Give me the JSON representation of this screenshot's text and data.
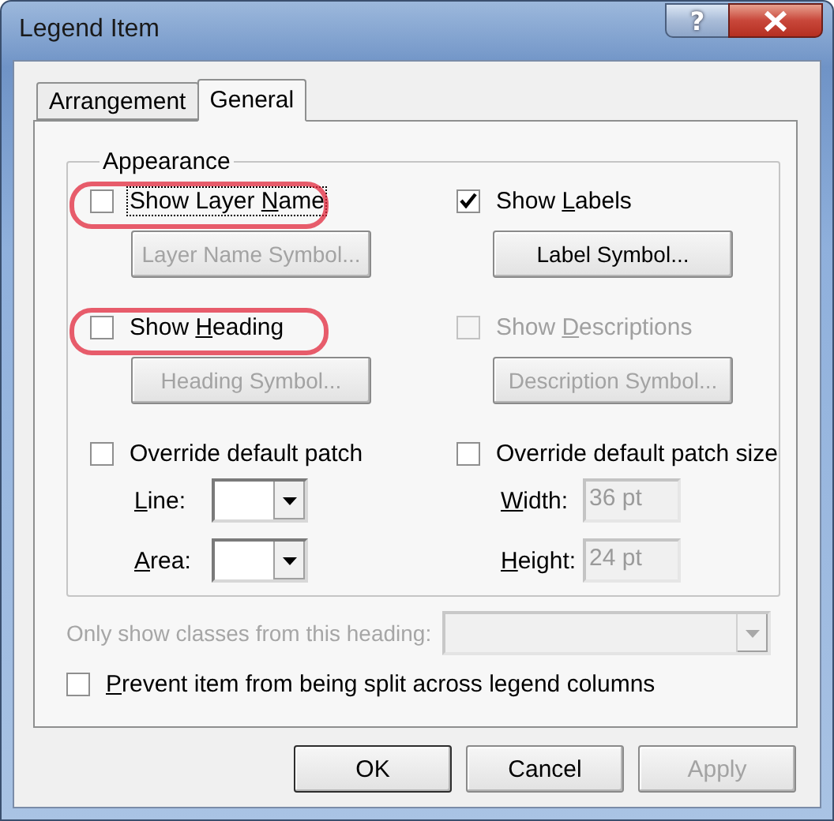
{
  "window": {
    "title": "Legend Item",
    "help_label": "?"
  },
  "tabs": [
    {
      "label": "Arrangement",
      "selected": false
    },
    {
      "label": "General",
      "selected": true
    }
  ],
  "appearance": {
    "title": "Appearance",
    "items": [
      {
        "kind": "checkbox",
        "label": "Show Layer ",
        "access_key": "N",
        "label_end": "ame",
        "checked": false,
        "disabled": false,
        "highlighted": true,
        "focused": true
      },
      {
        "kind": "checkbox",
        "label": "Show ",
        "access_key": "L",
        "label_end": "abels",
        "checked": true,
        "disabled": false,
        "highlighted": false,
        "focused": false
      },
      {
        "kind": "button",
        "label": "Layer Name Symbol...",
        "disabled": true
      },
      {
        "kind": "button",
        "label": "Label Symbol...",
        "disabled": false
      },
      {
        "kind": "checkbox",
        "label": "Show ",
        "access_key": "H",
        "label_end": "eading",
        "checked": false,
        "disabled": false,
        "highlighted": true,
        "focused": false
      },
      {
        "kind": "checkbox",
        "label": "Show ",
        "access_key": "D",
        "label_end": "escriptions",
        "checked": false,
        "disabled": true,
        "highlighted": false,
        "focused": false
      },
      {
        "kind": "button",
        "label": "Heading Symbol...",
        "disabled": true
      },
      {
        "kind": "button",
        "label": "Description Symbol...",
        "disabled": true
      },
      {
        "kind": "checkbox",
        "label": "Override default patch",
        "checked": false,
        "disabled": false,
        "highlighted": false,
        "focused": false
      },
      {
        "kind": "checkbox",
        "label": "Override default patch size",
        "checked": false,
        "disabled": false,
        "highlighted": false,
        "focused": false
      },
      {
        "kind": "combo",
        "access_key": "L",
        "label_end": "ine:",
        "disabled": false
      },
      {
        "kind": "field",
        "access_key": "W",
        "label_end": "idth:",
        "value": "36 pt",
        "disabled": true
      },
      {
        "kind": "combo",
        "access_key": "A",
        "label_end": "rea:",
        "disabled": false
      },
      {
        "kind": "field",
        "access_key": "H",
        "label_end": "eight:",
        "value": "24 pt",
        "disabled": true
      }
    ]
  },
  "heading_filter": {
    "label": "Only show classes from this heading:",
    "disabled": true
  },
  "prevent_split": {
    "access_key": "P",
    "label_end": "revent item from being split across legend columns",
    "checked": false
  },
  "buttons": [
    {
      "label": "OK",
      "disabled": false,
      "default": true
    },
    {
      "label": "Cancel",
      "disabled": false,
      "default": false
    },
    {
      "label": "Apply",
      "disabled": true,
      "default": false
    }
  ]
}
